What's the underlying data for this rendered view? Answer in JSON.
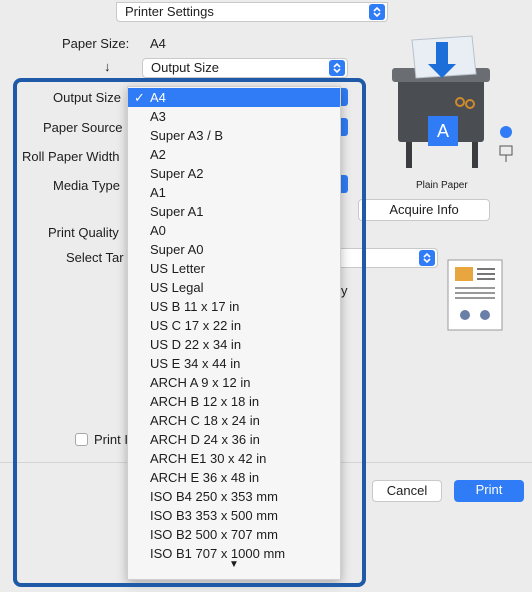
{
  "window": {
    "top_popup": "Printer Settings"
  },
  "form": {
    "paper_size_label": "Paper Size:",
    "paper_size_value": "A4",
    "arrow_glyph": "↓",
    "output_size_popup": "Output Size",
    "output_size_label": "Output Size",
    "paper_source_label": "Paper Source",
    "roll_paper_width_label": "Roll Paper Width",
    "media_type_label": "Media Type",
    "print_quality_label": "Print Quality",
    "select_target_label": "Select Tar",
    "y_fragment": "y",
    "print_checkbox_label": "Print I"
  },
  "printer_panel": {
    "plain_paper_label": "Plain Paper",
    "acquire_info_label": "Acquire Info",
    "preview_letter": "A"
  },
  "buttons": {
    "cancel": "Cancel",
    "print": "Print"
  },
  "menu": {
    "items": [
      "A4",
      "A3",
      "Super A3 / B",
      "A2",
      "Super A2",
      "A1",
      "Super A1",
      "A0",
      "Super A0",
      "US Letter",
      "US Legal",
      "US B 11 x 17 in",
      "US C 17 x 22 in",
      "US D 22 x 34 in",
      "US E 34 x 44 in",
      "ARCH A 9 x 12 in",
      "ARCH B 12 x 18 in",
      "ARCH C 18 x 24 in",
      "ARCH D 24 x 36 in",
      "ARCH E1 30 x 42 in",
      "ARCH E 36 x 48 in",
      "ISO B4 250 x 353 mm",
      "ISO B3 353 x 500 mm",
      "ISO B2 500 x 707 mm",
      "ISO B1 707 x 1000 mm"
    ],
    "selected_index": 0,
    "check_glyph": "✓",
    "more_glyph": "▼"
  },
  "colors": {
    "accent": "#2f7cf6",
    "highlight_frame": "#1f5aa8"
  }
}
